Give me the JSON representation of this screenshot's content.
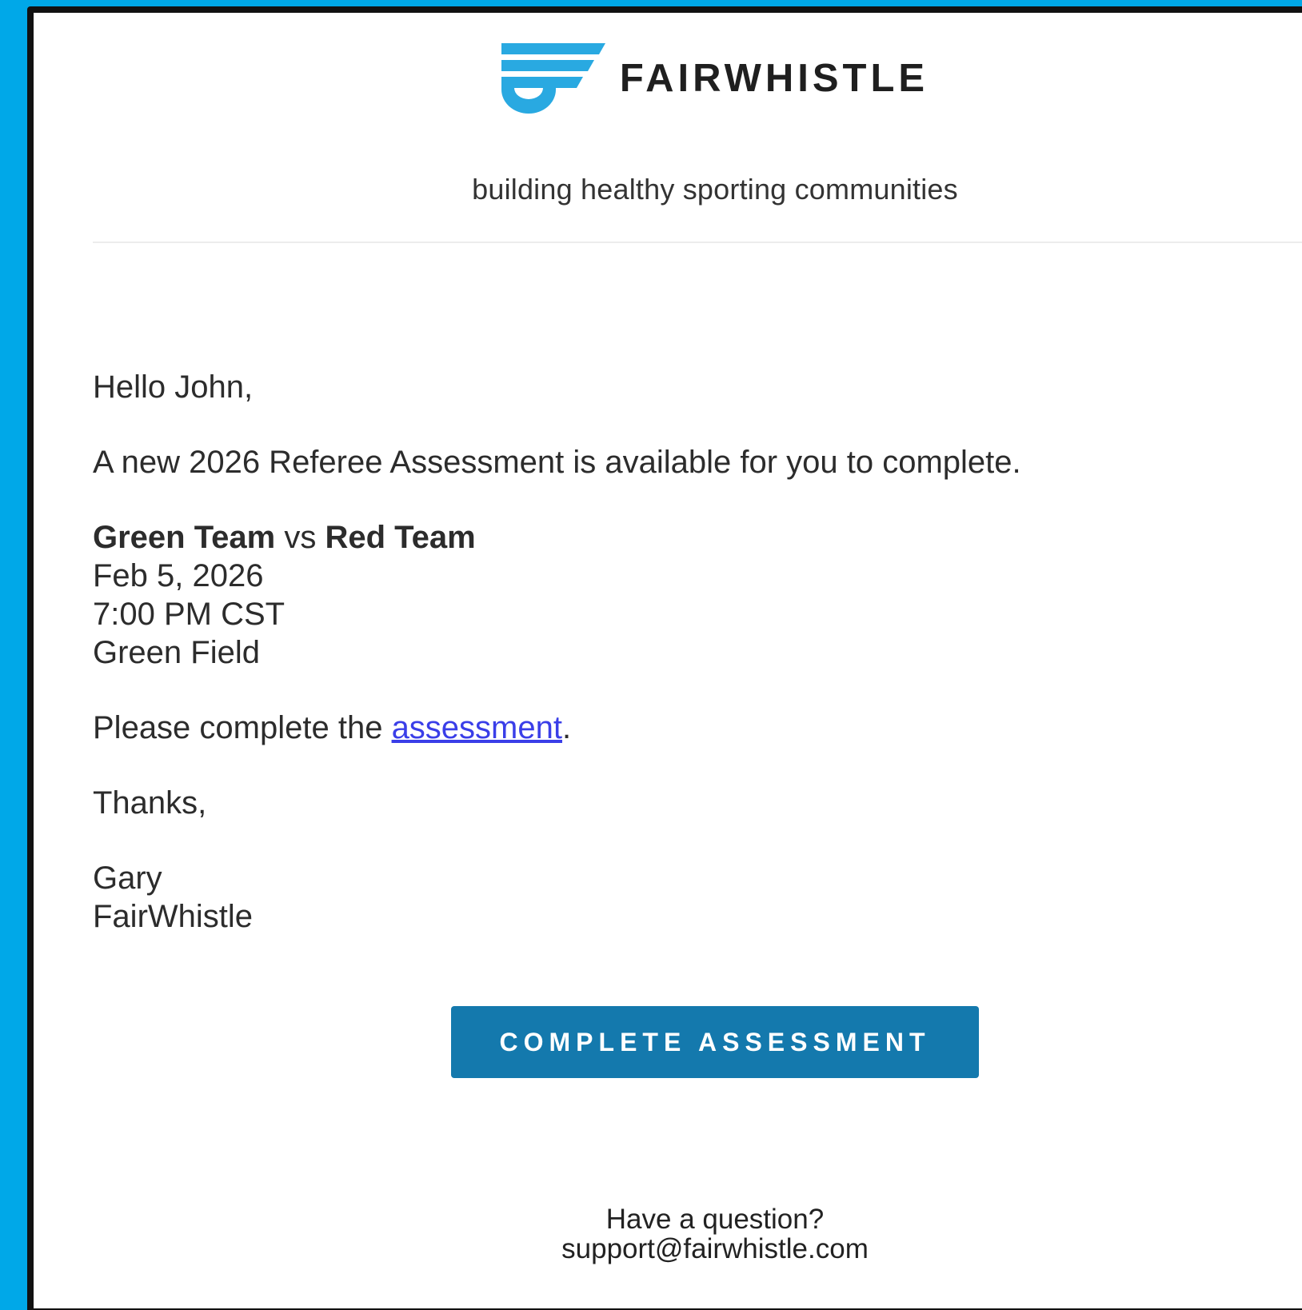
{
  "brand": {
    "wordmark": "FAIRWHISTLE",
    "tagline": "building healthy sporting communities",
    "logo_icon": "whistle-logo-icon",
    "accent_color": "#29a9e1"
  },
  "message": {
    "greeting": "Hello John,",
    "intro": "A new 2026 Referee Assessment is available for you to complete.",
    "match": {
      "home_team": "Green Team",
      "vs": "vs",
      "away_team": "Red Team",
      "date": "Feb 5, 2026",
      "time": "7:00 PM CST",
      "venue": "Green Field"
    },
    "instruction_prefix": "Please complete the ",
    "instruction_link": "assessment",
    "instruction_suffix": ".",
    "closing": "Thanks,",
    "signature_name": "Gary",
    "signature_org": "FairWhistle"
  },
  "cta": {
    "label": "COMPLETE ASSESSMENT",
    "color": "#1479ad"
  },
  "footer": {
    "question": "Have a question?",
    "support_email": "support@fairwhistle.com"
  },
  "colors": {
    "page_background": "#00a8e8",
    "link": "#3a3ee8"
  }
}
